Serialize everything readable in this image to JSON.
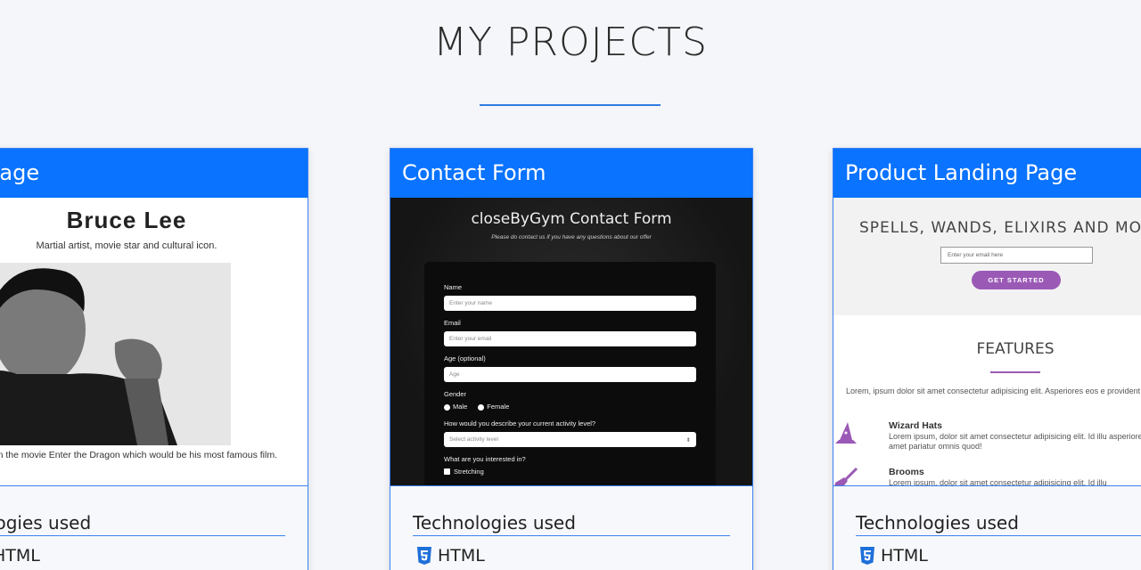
{
  "section": {
    "title": "MY PROJECTS"
  },
  "colors": {
    "accent": "#0a73ff",
    "rule": "#2f7be0",
    "landing_accent": "#9b59b6"
  },
  "projects": [
    {
      "title": "ute Page",
      "preview": {
        "heading": "Bruce Lee",
        "subheading": "Martial artist, movie star and cultural icon.",
        "caption": "Lee in the movie Enter the Dragon which would be his most famous film."
      },
      "tech_title": "nologies used",
      "tech": [
        {
          "label": "HTML",
          "icon": "html5-icon"
        }
      ]
    },
    {
      "title": "Contact Form",
      "preview": {
        "heading": "closeByGym Contact Form",
        "subheading": "Please do contact us if you have any questions about our offer",
        "fields": [
          {
            "label": "Name",
            "placeholder": "Enter your name"
          },
          {
            "label": "Email",
            "placeholder": "Enter your email"
          },
          {
            "label": "Age (optional)",
            "placeholder": "Age"
          }
        ],
        "gender_label": "Gender",
        "gender_options": [
          "Male",
          "Female"
        ],
        "activity_label": "How would you describe your current activity level?",
        "activity_select": "Select activity level",
        "interest_label": "What are you interested in?",
        "interest_option": "Stretching"
      },
      "tech_title": "Technologies used",
      "tech": [
        {
          "label": "HTML",
          "icon": "html5-icon"
        }
      ]
    },
    {
      "title": "Product Landing Page",
      "preview": {
        "heading": "SPELLS, WANDS, ELIXIRS AND MO",
        "email_placeholder": "Enter your email here",
        "button": "GET STARTED",
        "features_title": "FEATURES",
        "features_text": "Lorem, ipsum dolor sit amet consectetur adipisicing elit. Asperiores eos e provident ut.",
        "features": [
          {
            "name": "Wizard Hats",
            "icon": "wizard-hat-icon",
            "desc": "Lorem ipsum, dolor sit amet consectetur adipisicing elit. Id illu asperiores eveniet labore amet pariatur omnis quod!"
          },
          {
            "name": "Brooms",
            "icon": "broom-icon",
            "desc": "Lorem ipsum, dolor sit amet consectetur adipisicing elit. Id illu"
          }
        ]
      },
      "tech_title": "Technologies used",
      "tech": [
        {
          "label": "HTML",
          "icon": "html5-icon"
        }
      ]
    }
  ]
}
